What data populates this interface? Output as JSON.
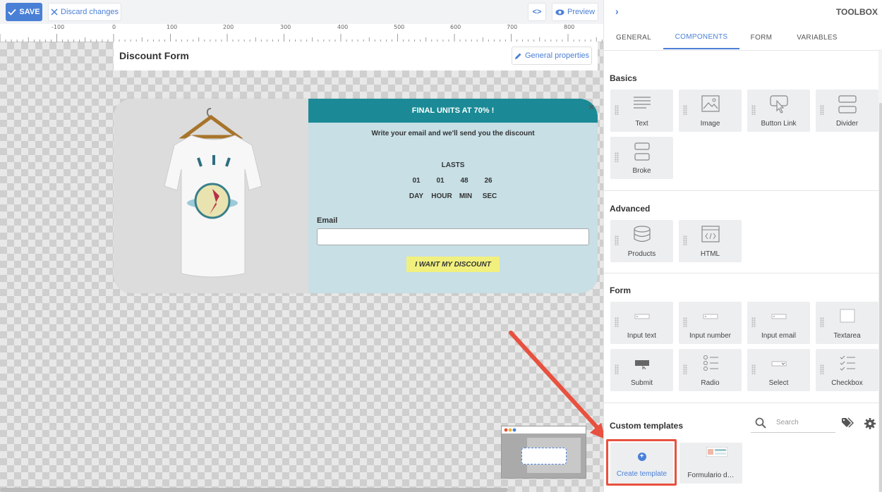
{
  "topbar": {
    "save_label": "SAVE",
    "discard_label": "Discard changes",
    "code_label": "<>",
    "preview_label": "Preview"
  },
  "ruler": {
    "labels": [
      "-100",
      "0",
      "100",
      "200",
      "300",
      "400",
      "500",
      "600",
      "700",
      "800"
    ]
  },
  "form": {
    "title": "Discount Form",
    "general_properties_label": "General properties"
  },
  "popup": {
    "banner": "FINAL UNITS AT 70% !",
    "subtitle": "Write your email and we'll send you the discount",
    "lasts_label": "LASTS",
    "countdown_values": [
      "01",
      "01",
      "48",
      "26"
    ],
    "countdown_units": [
      "DAY",
      "HOUR",
      "MIN",
      "SEC"
    ],
    "email_label": "Email",
    "cta_label": "I WANT MY DISCOUNT",
    "close_label": "×"
  },
  "toolbox": {
    "title": "TOOLBOX",
    "tabs": [
      "GENERAL",
      "COMPONENTS",
      "FORM",
      "VARIABLES"
    ],
    "active_tab": "COMPONENTS",
    "sections": {
      "basics": {
        "title": "Basics",
        "items": [
          {
            "label": "Text",
            "icon": "text-icon"
          },
          {
            "label": "Image",
            "icon": "image-icon"
          },
          {
            "label": "Button Link",
            "icon": "button-link-icon"
          },
          {
            "label": "Divider",
            "icon": "divider-icon"
          },
          {
            "label": "Broke",
            "icon": "break-icon"
          }
        ]
      },
      "advanced": {
        "title": "Advanced",
        "items": [
          {
            "label": "Products",
            "icon": "products-icon"
          },
          {
            "label": "HTML",
            "icon": "html-icon"
          }
        ]
      },
      "form": {
        "title": "Form",
        "items": [
          {
            "label": "Input text",
            "icon": "input-text-icon"
          },
          {
            "label": "Input number",
            "icon": "input-number-icon"
          },
          {
            "label": "Input email",
            "icon": "input-email-icon"
          },
          {
            "label": "Textarea",
            "icon": "textarea-icon"
          },
          {
            "label": "Submit",
            "icon": "submit-icon"
          },
          {
            "label": "Radio",
            "icon": "radio-icon"
          },
          {
            "label": "Select",
            "icon": "select-icon"
          },
          {
            "label": "Checkbox",
            "icon": "checkbox-icon"
          }
        ]
      },
      "custom_templates": {
        "title": "Custom templates",
        "search_placeholder": "Search",
        "create_label": "Create template",
        "template_label": "Formulario d…"
      }
    }
  },
  "colors": {
    "accent": "#4a7fd6",
    "banner": "#1b8a96",
    "popup_bg": "#c7dfe5",
    "cta": "#f1f07e",
    "highlight": "#e8513f"
  }
}
